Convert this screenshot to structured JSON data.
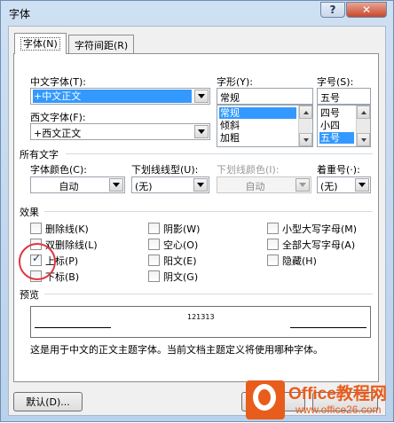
{
  "window": {
    "title": "字体",
    "help_glyph": "?",
    "close_glyph": "✕"
  },
  "tabs": [
    {
      "label": "字体(N)"
    },
    {
      "label": "字符间距(R)"
    }
  ],
  "font": {
    "chinese_label": "中文字体(T):",
    "chinese_value": "+中文正文",
    "western_label": "西文字体(F):",
    "western_value": "+西文正文",
    "style_label": "字形(Y):",
    "style_value": "常规",
    "style_options": [
      "常规",
      "倾斜",
      "加粗"
    ],
    "size_label": "字号(S):",
    "size_value": "五号",
    "size_options": [
      "四号",
      "小四",
      "五号"
    ]
  },
  "all_text": {
    "section": "所有文字",
    "color_label": "字体颜色(C):",
    "color_value": "自动",
    "underline_label": "下划线线型(U):",
    "underline_value": "(无)",
    "underline_color_label": "下划线颜色(I):",
    "underline_color_value": "自动",
    "emphasis_label": "着重号(·):",
    "emphasis_value": "(无)"
  },
  "effects": {
    "section": "效果",
    "items": [
      {
        "label": "删除线(K)",
        "checked": false
      },
      {
        "label": "双删除线(L)",
        "checked": false
      },
      {
        "label": "上标(P)",
        "checked": true
      },
      {
        "label": "下标(B)",
        "checked": false
      },
      {
        "label": "阴影(W)",
        "checked": false
      },
      {
        "label": "空心(O)",
        "checked": false
      },
      {
        "label": "阳文(E)",
        "checked": false
      },
      {
        "label": "阴文(G)",
        "checked": false
      },
      {
        "label": "小型大写字母(M)",
        "checked": false
      },
      {
        "label": "全部大写字母(A)",
        "checked": false
      },
      {
        "label": "隐藏(H)",
        "checked": false
      }
    ]
  },
  "preview": {
    "section": "预览",
    "sample": "121313",
    "description": "这是用于中文的正文主题字体。当前文档主题定义将使用哪种字体。"
  },
  "buttons": {
    "default_label": "默认(D)..."
  },
  "watermark": {
    "brand": "Office教程网",
    "url": "www.office26.com"
  },
  "colors": {
    "selection": "#3399ff",
    "circle": "#e0373f",
    "logo": "#e85c1c"
  }
}
